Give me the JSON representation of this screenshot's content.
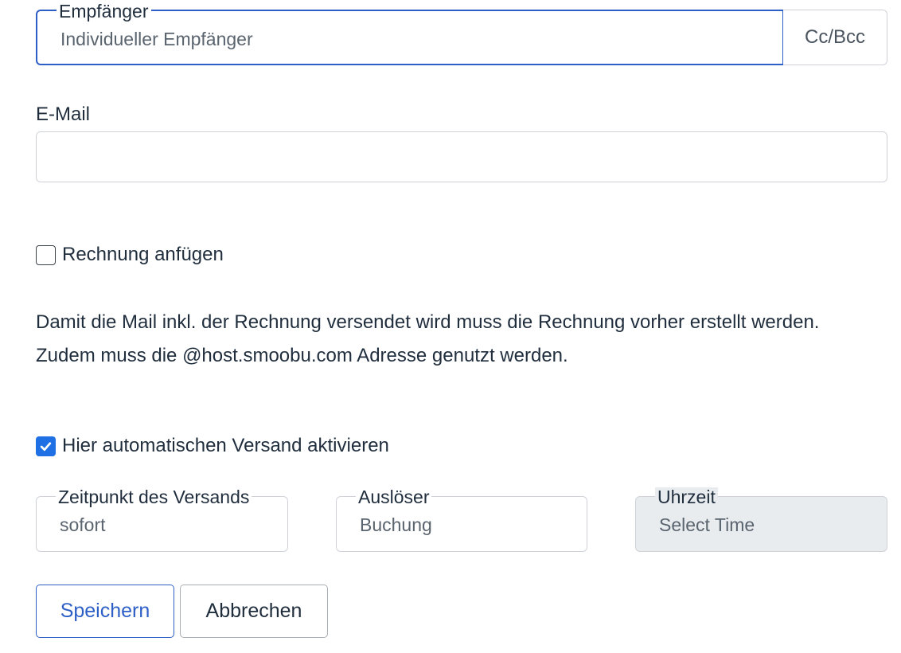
{
  "recipient": {
    "label": "Empfänger",
    "value": "Individueller Empfänger",
    "cc_bcc_label": "Cc/Bcc"
  },
  "email": {
    "label": "E-Mail",
    "value": "",
    "placeholder": ""
  },
  "attach_invoice": {
    "label": "Rechnung anfügen",
    "checked": false
  },
  "info": {
    "line1": "Damit die Mail inkl. der Rechnung versendet wird muss die Rechnung vorher erstellt werden.",
    "line2": "Zudem muss die @host.smoobu.com Adresse genutzt werden."
  },
  "auto_send": {
    "label": "Hier automatischen Versand aktivieren",
    "checked": true
  },
  "timing": {
    "label": "Zeitpunkt des Versands",
    "value": "sofort"
  },
  "trigger": {
    "label": "Auslöser",
    "value": "Buchung"
  },
  "time": {
    "label": "Uhrzeit",
    "value": "Select Time"
  },
  "buttons": {
    "save": "Speichern",
    "cancel": "Abbrechen"
  },
  "colors": {
    "accent": "#2d5fc7",
    "checkbox_checked": "#1f6fe5",
    "disabled_bg": "#e9ecef"
  }
}
